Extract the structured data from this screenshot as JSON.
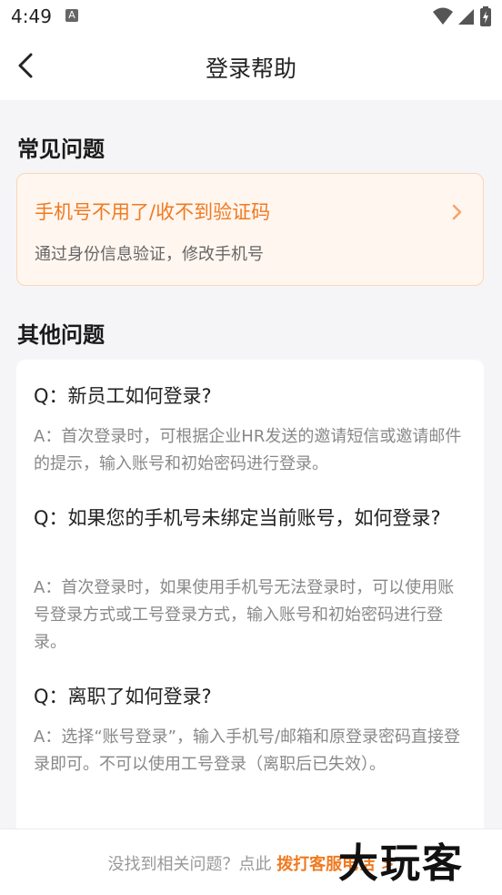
{
  "status_bar": {
    "time": "4:49",
    "badge": "A"
  },
  "nav": {
    "title": "登录帮助"
  },
  "sections": {
    "common_title": "常见问题",
    "other_title": "其他问题"
  },
  "faq": {
    "title": "手机号不用了/收不到验证码",
    "subtitle": "通过身份信息验证，修改手机号"
  },
  "qa": [
    {
      "q": "Q：新员工如何登录?",
      "a": "A：首次登录时，可根据企业HR发送的邀请短信或邀请邮件的提示，输入账号和初始密码进行登录。"
    },
    {
      "q": "Q：如果您的手机号未绑定当前账号，如何登录?",
      "a": "A：首次登录时，如果使用手机号无法登录时，可以使用账号登录方式或工号登录方式，输入账号和初始密码进行登录。"
    },
    {
      "q": "Q：离职了如何登录?",
      "a": "A：选择“账号登录”，输入手机号/邮箱和原登录密码直接登录即可。不可以使用工号登录（离职后已失效）。"
    }
  ],
  "footer": {
    "prefix": "没找到相关问题？点此 ",
    "link": "拨打客服电话 >"
  },
  "watermark": "大玩客",
  "colors": {
    "accent": "#f07a20",
    "card_bg": "#fff6ef"
  }
}
